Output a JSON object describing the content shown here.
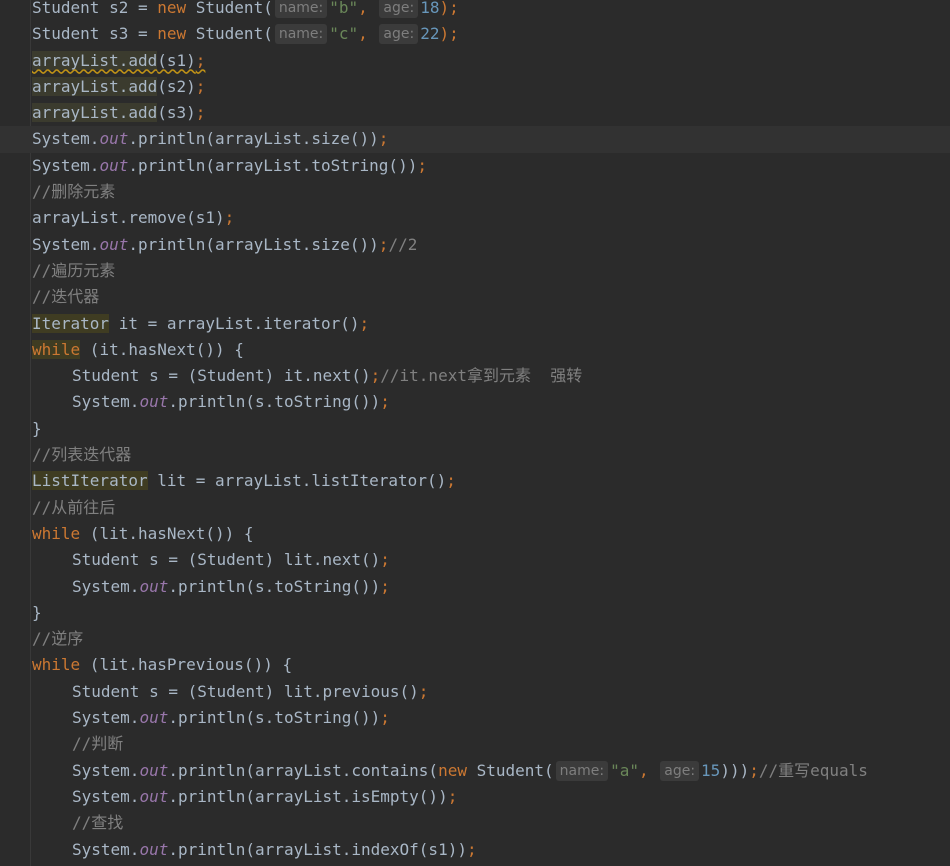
{
  "editor": {
    "lines": [
      {
        "indent": 0,
        "current": false,
        "tokens": [
          {
            "t": "Student s2 = ",
            "c": ""
          },
          {
            "t": "new ",
            "c": "kw"
          },
          {
            "t": "Student(",
            "c": ""
          },
          {
            "t": "name:",
            "c": "hint"
          },
          {
            "t": "\"b\"",
            "c": "str"
          },
          {
            "t": ", ",
            "c": "punc"
          },
          {
            "t": "age:",
            "c": "hint"
          },
          {
            "t": "18",
            "c": "num"
          },
          {
            "t": ");",
            "c": "punc"
          }
        ]
      },
      {
        "indent": 0,
        "current": false,
        "tokens": [
          {
            "t": "Student s3 = ",
            "c": ""
          },
          {
            "t": "new ",
            "c": "kw"
          },
          {
            "t": "Student(",
            "c": ""
          },
          {
            "t": "name:",
            "c": "hint"
          },
          {
            "t": "\"c\"",
            "c": "str"
          },
          {
            "t": ", ",
            "c": "punc"
          },
          {
            "t": "age:",
            "c": "hint"
          },
          {
            "t": "22",
            "c": "num"
          },
          {
            "t": ");",
            "c": "punc"
          }
        ]
      },
      {
        "indent": 0,
        "current": false,
        "tokens": [
          {
            "t": "arrayList.add",
            "c": "hl warn"
          },
          {
            "t": "(s1)",
            "c": "warn"
          },
          {
            "t": ";",
            "c": "punc warn"
          }
        ]
      },
      {
        "indent": 0,
        "current": false,
        "tokens": [
          {
            "t": "arrayList.add",
            "c": "hl"
          },
          {
            "t": "(s2)",
            "c": ""
          },
          {
            "t": ";",
            "c": "punc"
          }
        ]
      },
      {
        "indent": 0,
        "current": false,
        "tokens": [
          {
            "t": "arrayList.add",
            "c": "hl"
          },
          {
            "t": "(s3)",
            "c": ""
          },
          {
            "t": ";",
            "c": "punc"
          }
        ]
      },
      {
        "indent": 0,
        "current": true,
        "tokens": [
          {
            "t": "System.",
            "c": ""
          },
          {
            "t": "out",
            "c": "field"
          },
          {
            "t": ".println(arrayList.size())",
            "c": ""
          },
          {
            "t": ";",
            "c": "punc"
          }
        ]
      },
      {
        "indent": 0,
        "current": false,
        "tokens": [
          {
            "t": "System.",
            "c": ""
          },
          {
            "t": "out",
            "c": "field"
          },
          {
            "t": ".println(arrayList.toString())",
            "c": ""
          },
          {
            "t": ";",
            "c": "punc"
          }
        ]
      },
      {
        "indent": 0,
        "current": false,
        "tokens": [
          {
            "t": "//删除元素",
            "c": "cmt"
          }
        ]
      },
      {
        "indent": 0,
        "current": false,
        "tokens": [
          {
            "t": "arrayList.remove(s1)",
            "c": ""
          },
          {
            "t": ";",
            "c": "punc"
          }
        ]
      },
      {
        "indent": 0,
        "current": false,
        "tokens": [
          {
            "t": "System.",
            "c": ""
          },
          {
            "t": "out",
            "c": "field"
          },
          {
            "t": ".println(arrayList.size())",
            "c": ""
          },
          {
            "t": ";",
            "c": "punc"
          },
          {
            "t": "//2",
            "c": "cmt"
          }
        ]
      },
      {
        "indent": 0,
        "current": false,
        "tokens": [
          {
            "t": "//遍历元素",
            "c": "cmt"
          }
        ]
      },
      {
        "indent": 0,
        "current": false,
        "tokens": [
          {
            "t": "//迭代器",
            "c": "cmt"
          }
        ]
      },
      {
        "indent": 0,
        "current": false,
        "tokens": [
          {
            "t": "Iterator",
            "c": "hlw"
          },
          {
            "t": " it = arrayList.iterator()",
            "c": ""
          },
          {
            "t": ";",
            "c": "punc"
          }
        ]
      },
      {
        "indent": 0,
        "current": false,
        "tokens": [
          {
            "t": "while",
            "c": "kw hlw"
          },
          {
            "t": " (it.hasNext()) {",
            "c": ""
          }
        ]
      },
      {
        "indent": 1,
        "current": false,
        "tokens": [
          {
            "t": "Student s = (Student) it.next()",
            "c": ""
          },
          {
            "t": ";",
            "c": "punc"
          },
          {
            "t": "//it.next拿到元素  强转",
            "c": "cmt"
          }
        ]
      },
      {
        "indent": 1,
        "current": false,
        "tokens": [
          {
            "t": "System.",
            "c": ""
          },
          {
            "t": "out",
            "c": "field"
          },
          {
            "t": ".println(s.toString())",
            "c": ""
          },
          {
            "t": ";",
            "c": "punc"
          }
        ]
      },
      {
        "indent": 0,
        "current": false,
        "tokens": [
          {
            "t": "}",
            "c": ""
          }
        ]
      },
      {
        "indent": 0,
        "current": false,
        "tokens": [
          {
            "t": "//列表迭代器",
            "c": "cmt"
          }
        ]
      },
      {
        "indent": 0,
        "current": false,
        "tokens": [
          {
            "t": "ListIterator",
            "c": "hlw"
          },
          {
            "t": " lit = arrayList.listIterator()",
            "c": ""
          },
          {
            "t": ";",
            "c": "punc"
          }
        ]
      },
      {
        "indent": 0,
        "current": false,
        "tokens": [
          {
            "t": "//从前往后",
            "c": "cmt"
          }
        ]
      },
      {
        "indent": 0,
        "current": false,
        "tokens": [
          {
            "t": "while",
            "c": "kw"
          },
          {
            "t": " (lit.hasNext()) {",
            "c": ""
          }
        ]
      },
      {
        "indent": 1,
        "current": false,
        "tokens": [
          {
            "t": "Student s = (Student) lit.next()",
            "c": ""
          },
          {
            "t": ";",
            "c": "punc"
          }
        ]
      },
      {
        "indent": 1,
        "current": false,
        "tokens": [
          {
            "t": "System.",
            "c": ""
          },
          {
            "t": "out",
            "c": "field"
          },
          {
            "t": ".println(s.toString())",
            "c": ""
          },
          {
            "t": ";",
            "c": "punc"
          }
        ]
      },
      {
        "indent": 0,
        "current": false,
        "tokens": [
          {
            "t": "}",
            "c": ""
          }
        ]
      },
      {
        "indent": 0,
        "current": false,
        "tokens": [
          {
            "t": "//逆序",
            "c": "cmt"
          }
        ]
      },
      {
        "indent": 0,
        "current": false,
        "tokens": [
          {
            "t": "while",
            "c": "kw"
          },
          {
            "t": " (lit.hasPrevious()) {",
            "c": ""
          }
        ]
      },
      {
        "indent": 1,
        "current": false,
        "tokens": [
          {
            "t": "Student s = (Student) lit.previous()",
            "c": ""
          },
          {
            "t": ";",
            "c": "punc"
          }
        ]
      },
      {
        "indent": 1,
        "current": false,
        "tokens": [
          {
            "t": "System.",
            "c": ""
          },
          {
            "t": "out",
            "c": "field"
          },
          {
            "t": ".println(s.toString())",
            "c": ""
          },
          {
            "t": ";",
            "c": "punc"
          }
        ]
      },
      {
        "indent": 1,
        "current": false,
        "tokens": [
          {
            "t": "//判断",
            "c": "cmt"
          }
        ]
      },
      {
        "indent": 1,
        "current": false,
        "tokens": [
          {
            "t": "System.",
            "c": ""
          },
          {
            "t": "out",
            "c": "field"
          },
          {
            "t": ".println(arrayList.contains(",
            "c": ""
          },
          {
            "t": "new ",
            "c": "kw"
          },
          {
            "t": "Student(",
            "c": ""
          },
          {
            "t": "name:",
            "c": "hint"
          },
          {
            "t": "\"a\"",
            "c": "str"
          },
          {
            "t": ", ",
            "c": "punc"
          },
          {
            "t": "age:",
            "c": "hint"
          },
          {
            "t": "15",
            "c": "num"
          },
          {
            "t": ")))",
            "c": ""
          },
          {
            "t": ";",
            "c": "punc"
          },
          {
            "t": "//重写equals",
            "c": "cmt"
          }
        ]
      },
      {
        "indent": 1,
        "current": false,
        "tokens": [
          {
            "t": "System.",
            "c": ""
          },
          {
            "t": "out",
            "c": "field"
          },
          {
            "t": ".println(arrayList.isEmpty())",
            "c": ""
          },
          {
            "t": ";",
            "c": "punc"
          }
        ]
      },
      {
        "indent": 1,
        "current": false,
        "tokens": [
          {
            "t": "//查找",
            "c": "cmt"
          }
        ]
      },
      {
        "indent": 1,
        "current": false,
        "tokens": [
          {
            "t": "System.",
            "c": ""
          },
          {
            "t": "out",
            "c": "field"
          },
          {
            "t": ".println(arrayList.indexOf(s1))",
            "c": ""
          },
          {
            "t": ";",
            "c": "punc"
          }
        ]
      }
    ]
  }
}
